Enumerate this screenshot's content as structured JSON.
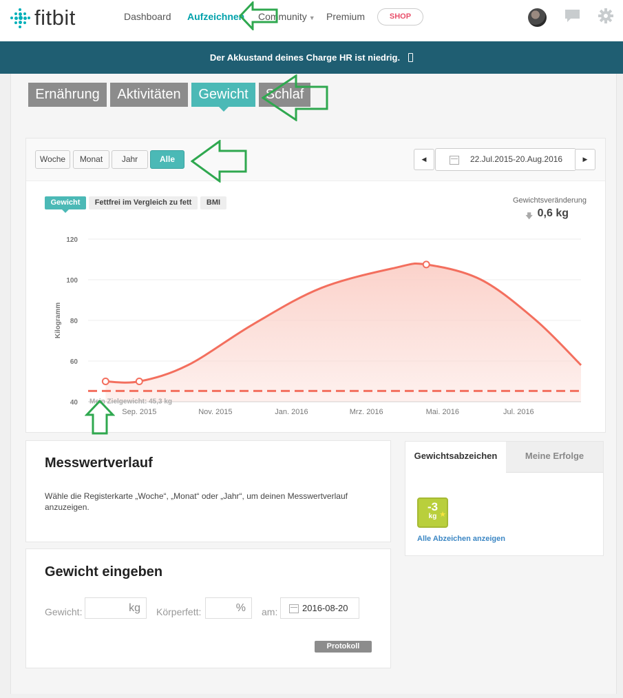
{
  "brand": {
    "name": "fitbit"
  },
  "nav": {
    "items": [
      {
        "label": "Dashboard"
      },
      {
        "label": "Aufzeichnen"
      },
      {
        "label": "Community"
      },
      {
        "label": "Premium"
      }
    ],
    "shop_label": "SHOP",
    "icons": [
      "avatar",
      "chat-icon",
      "gear-icon"
    ]
  },
  "banner": {
    "message": "Der Akkustand deines Charge HR ist niedrig.",
    "icon": "battery-icon"
  },
  "categories": [
    {
      "label": "Ernährung"
    },
    {
      "label": "Aktivitäten"
    },
    {
      "label": "Gewicht"
    },
    {
      "label": "Schlaf"
    }
  ],
  "range": {
    "buttons": [
      {
        "label": "Woche"
      },
      {
        "label": "Monat"
      },
      {
        "label": "Jahr"
      },
      {
        "label": "Alle"
      }
    ],
    "date_range": "22.Jul.2015-20.Aug.2016"
  },
  "metrics": {
    "tabs": [
      {
        "label": "Gewicht"
      },
      {
        "label": "Fettfrei im Vergleich zu fett"
      },
      {
        "label": "BMI"
      }
    ],
    "change_label": "Gewichtsveränderung",
    "change_value": "0,6 kg"
  },
  "chart_data": {
    "type": "area",
    "ylabel": "Kilogramm",
    "ylim": [
      40,
      120
    ],
    "yticks": [
      40,
      60,
      80,
      100,
      120
    ],
    "xticks": [
      "Sep. 2015",
      "Nov. 2015",
      "Jan. 2016",
      "Mrz. 2016",
      "Mai. 2016",
      "Jul. 2016"
    ],
    "xtick_dates": [
      "2015-09-01",
      "2015-11-01",
      "2016-01-01",
      "2016-03-01",
      "2016-05-01",
      "2016-07-01"
    ],
    "x_range": [
      "2015-07-22",
      "2016-08-20"
    ],
    "series": [
      {
        "points": [
          {
            "x": "2015-08-05",
            "y": 50,
            "marker": true
          },
          {
            "x": "2015-09-01",
            "y": 50,
            "marker": true
          },
          {
            "x": "2015-10-10",
            "y": 58
          },
          {
            "x": "2015-12-01",
            "y": 78
          },
          {
            "x": "2016-01-25",
            "y": 96
          },
          {
            "x": "2016-03-25",
            "y": 106
          },
          {
            "x": "2016-04-18",
            "y": 107.5,
            "marker": true
          },
          {
            "x": "2016-06-01",
            "y": 100
          },
          {
            "x": "2016-07-15",
            "y": 80
          },
          {
            "x": "2016-08-20",
            "y": 58
          }
        ]
      }
    ],
    "goal": {
      "label": "Mein Zielgewicht: 45,3 kg",
      "value": 45.3
    },
    "colors": {
      "line": "#f36f5e",
      "fill": "#fbd0c8",
      "goal": "#f36f5e"
    }
  },
  "history": {
    "title": "Messwertverlauf",
    "text": "Wähle die Registerkarte „Woche“, „Monat“ oder „Jahr“, um deinen Messwertverlauf anzuzeigen."
  },
  "entry": {
    "title": "Gewicht eingeben",
    "weight_label": "Gewicht:",
    "weight_unit": "kg",
    "fat_label": "Körperfett:",
    "fat_unit": "%",
    "date_label": "am:",
    "date_value": "2016-08-20",
    "submit_label": "Protokoll"
  },
  "badges": {
    "tabs": [
      {
        "label": "Gewichtsabzeichen"
      },
      {
        "label": "Meine Erfolge"
      }
    ],
    "badge_value": "-3",
    "badge_unit": "kg",
    "link_label": "Alle Abzeichen anzeigen"
  },
  "colors": {
    "accent": "#4bb9b6",
    "banner": "#1f5e72",
    "annotation": "#2fa84f"
  }
}
